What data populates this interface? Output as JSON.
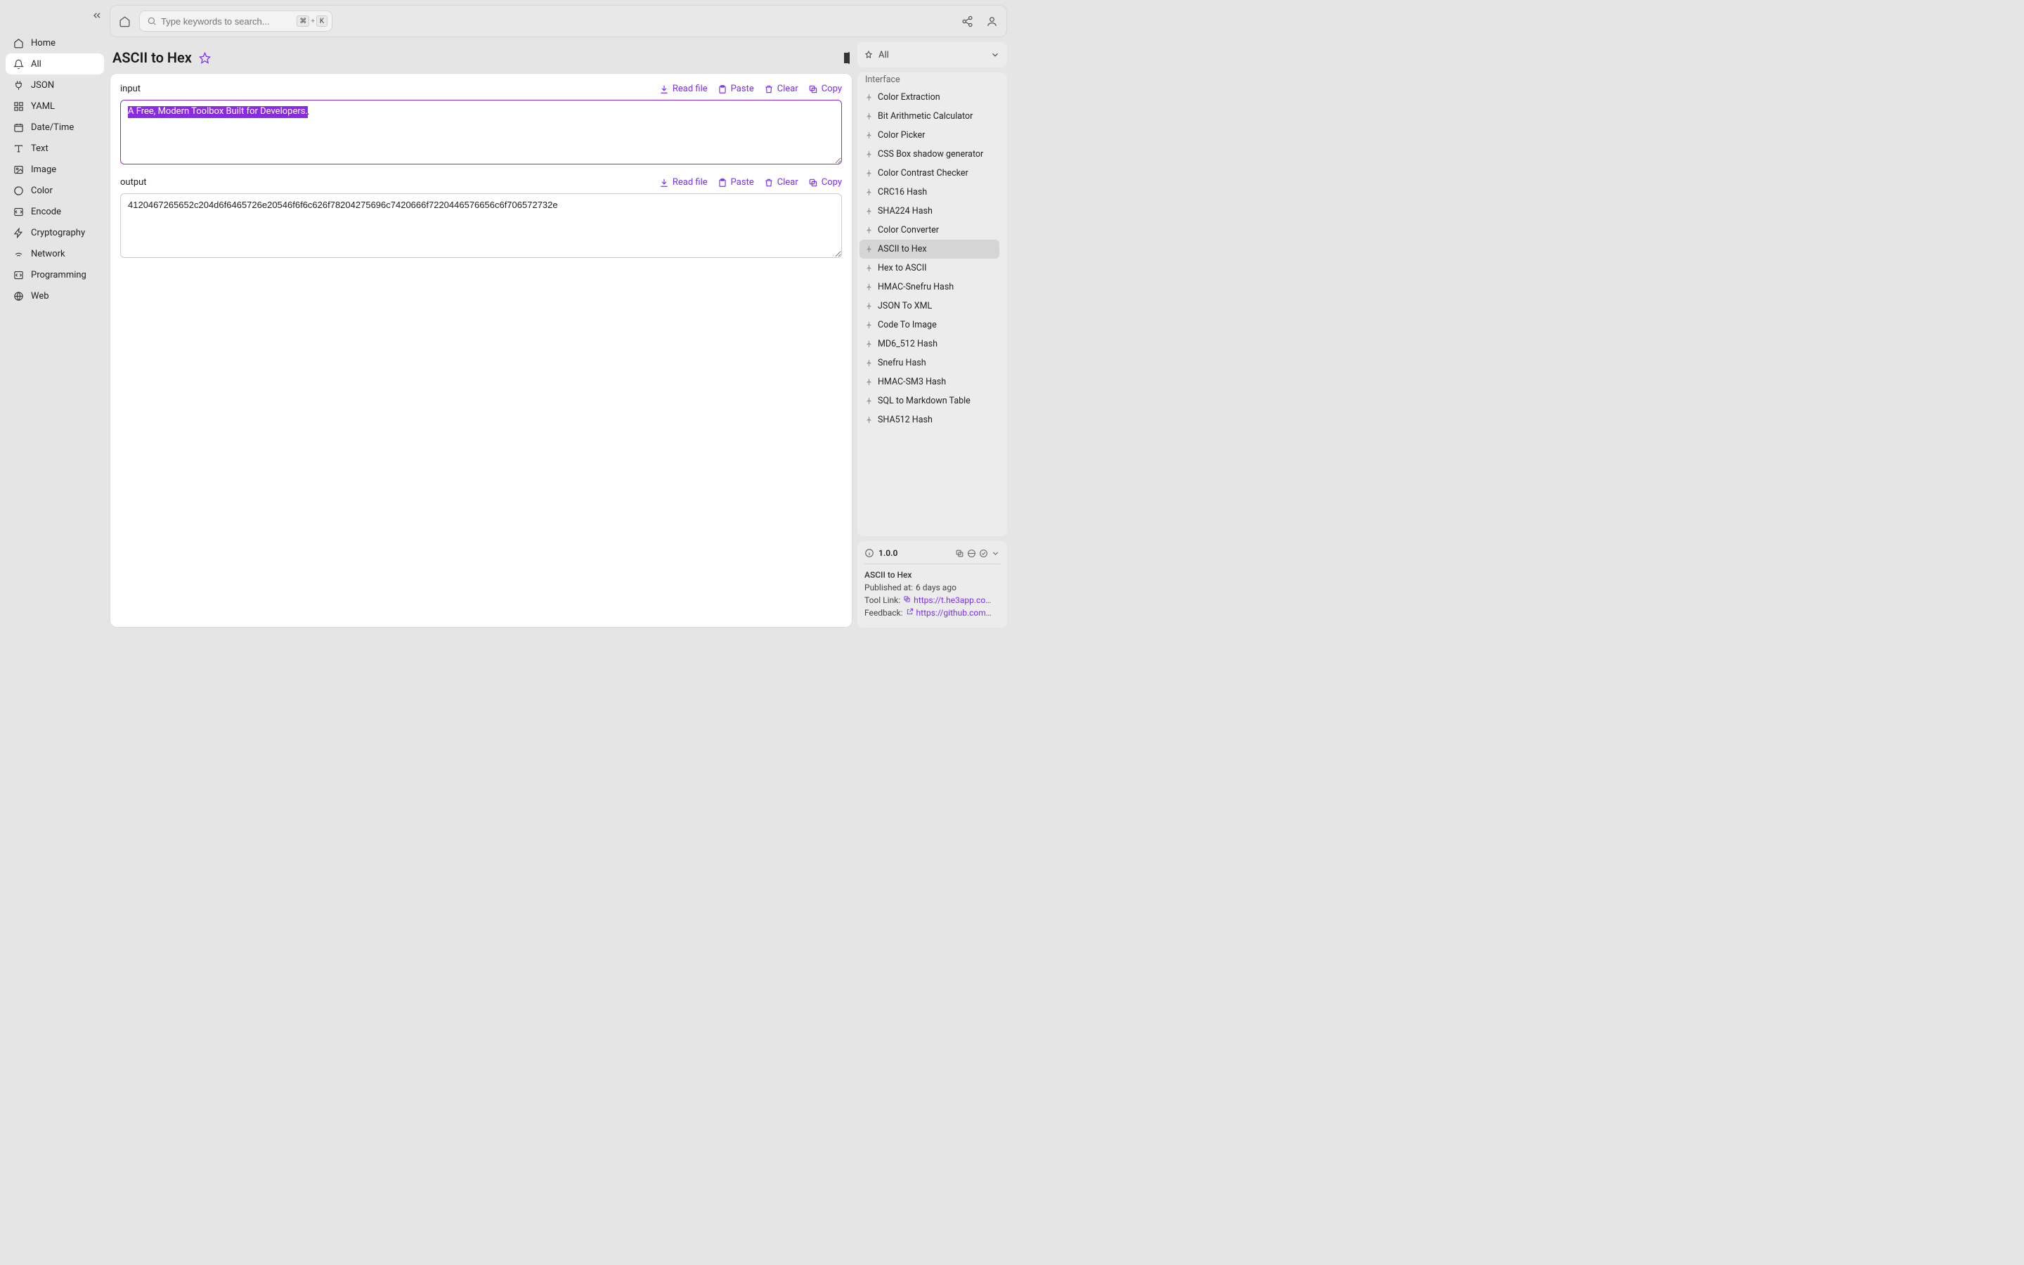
{
  "search": {
    "placeholder": "Type keywords to search...",
    "cmdKey": "⌘",
    "plus": "+",
    "kKey": "K"
  },
  "sidebar": {
    "items": [
      {
        "label": "Home"
      },
      {
        "label": "All"
      },
      {
        "label": "JSON"
      },
      {
        "label": "YAML"
      },
      {
        "label": "Date/Time"
      },
      {
        "label": "Text"
      },
      {
        "label": "Image"
      },
      {
        "label": "Color"
      },
      {
        "label": "Encode"
      },
      {
        "label": "Cryptography"
      },
      {
        "label": "Network"
      },
      {
        "label": "Programming"
      },
      {
        "label": "Web"
      }
    ]
  },
  "page": {
    "title": "ASCII to Hex",
    "input_label": "input",
    "output_label": "output",
    "actions": {
      "read_file": "Read file",
      "paste": "Paste",
      "clear": "Clear",
      "copy": "Copy"
    },
    "input_value": "A Free, Modern Toolbox Built for Developers.",
    "output_value": "4120467265652c204d6f6465726e20546f6f6c626f78204275696c7420666f7220446576656c6f706572732e"
  },
  "right": {
    "filter_label": "All",
    "truncated_top": "Interface",
    "items": [
      "Color Extraction",
      "Bit Arithmetic Calculator",
      "Color Picker",
      "CSS Box shadow generator",
      "Color Contrast Checker",
      "CRC16 Hash",
      "SHA224 Hash",
      "Color Converter",
      "ASCII to Hex",
      "Hex to ASCII",
      "HMAC-Snefru Hash",
      "JSON To XML",
      "Code To Image",
      "MD6_512 Hash",
      "Snefru Hash",
      "HMAC-SM3 Hash",
      "SQL to Markdown Table",
      "SHA512 Hash"
    ],
    "active_index": 8
  },
  "info": {
    "version": "1.0.0",
    "title": "ASCII to Hex",
    "published_label": "Published at:",
    "published_value": "6 days ago",
    "tool_link_label": "Tool Link:",
    "tool_link_value": "https://t.he3app.co…",
    "feedback_label": "Feedback:",
    "feedback_value": "https://github.com/…"
  }
}
